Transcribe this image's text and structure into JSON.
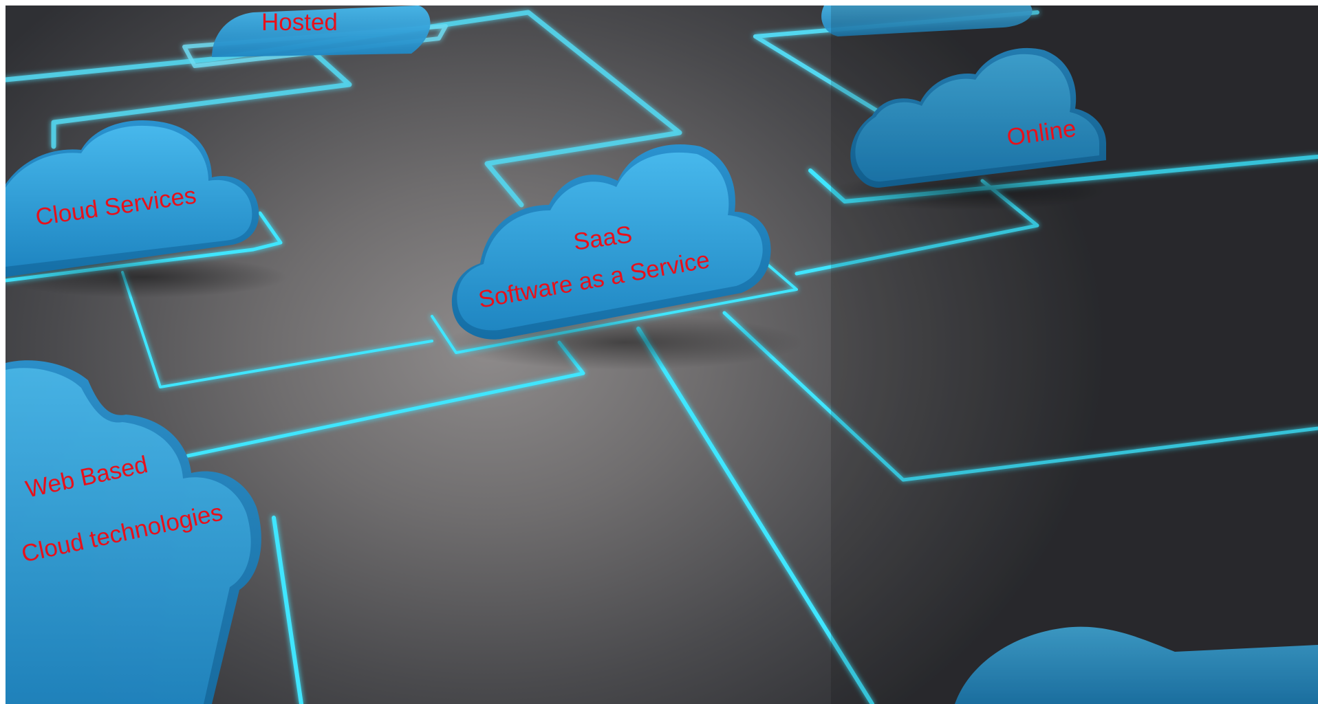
{
  "labels": {
    "hosted": "Hosted",
    "cloud_services": "Cloud Services",
    "saas_title": "SaaS",
    "saas_subtitle": "Software as a Service",
    "online": "Online",
    "web_based": "Web Based",
    "cloud_technologies": "Cloud technologies"
  },
  "colors": {
    "label_text": "#e8101a",
    "cloud_fill": "#2fa3dc",
    "circuit_line": "#3fe6ff",
    "surface": "#5b5a5c"
  }
}
